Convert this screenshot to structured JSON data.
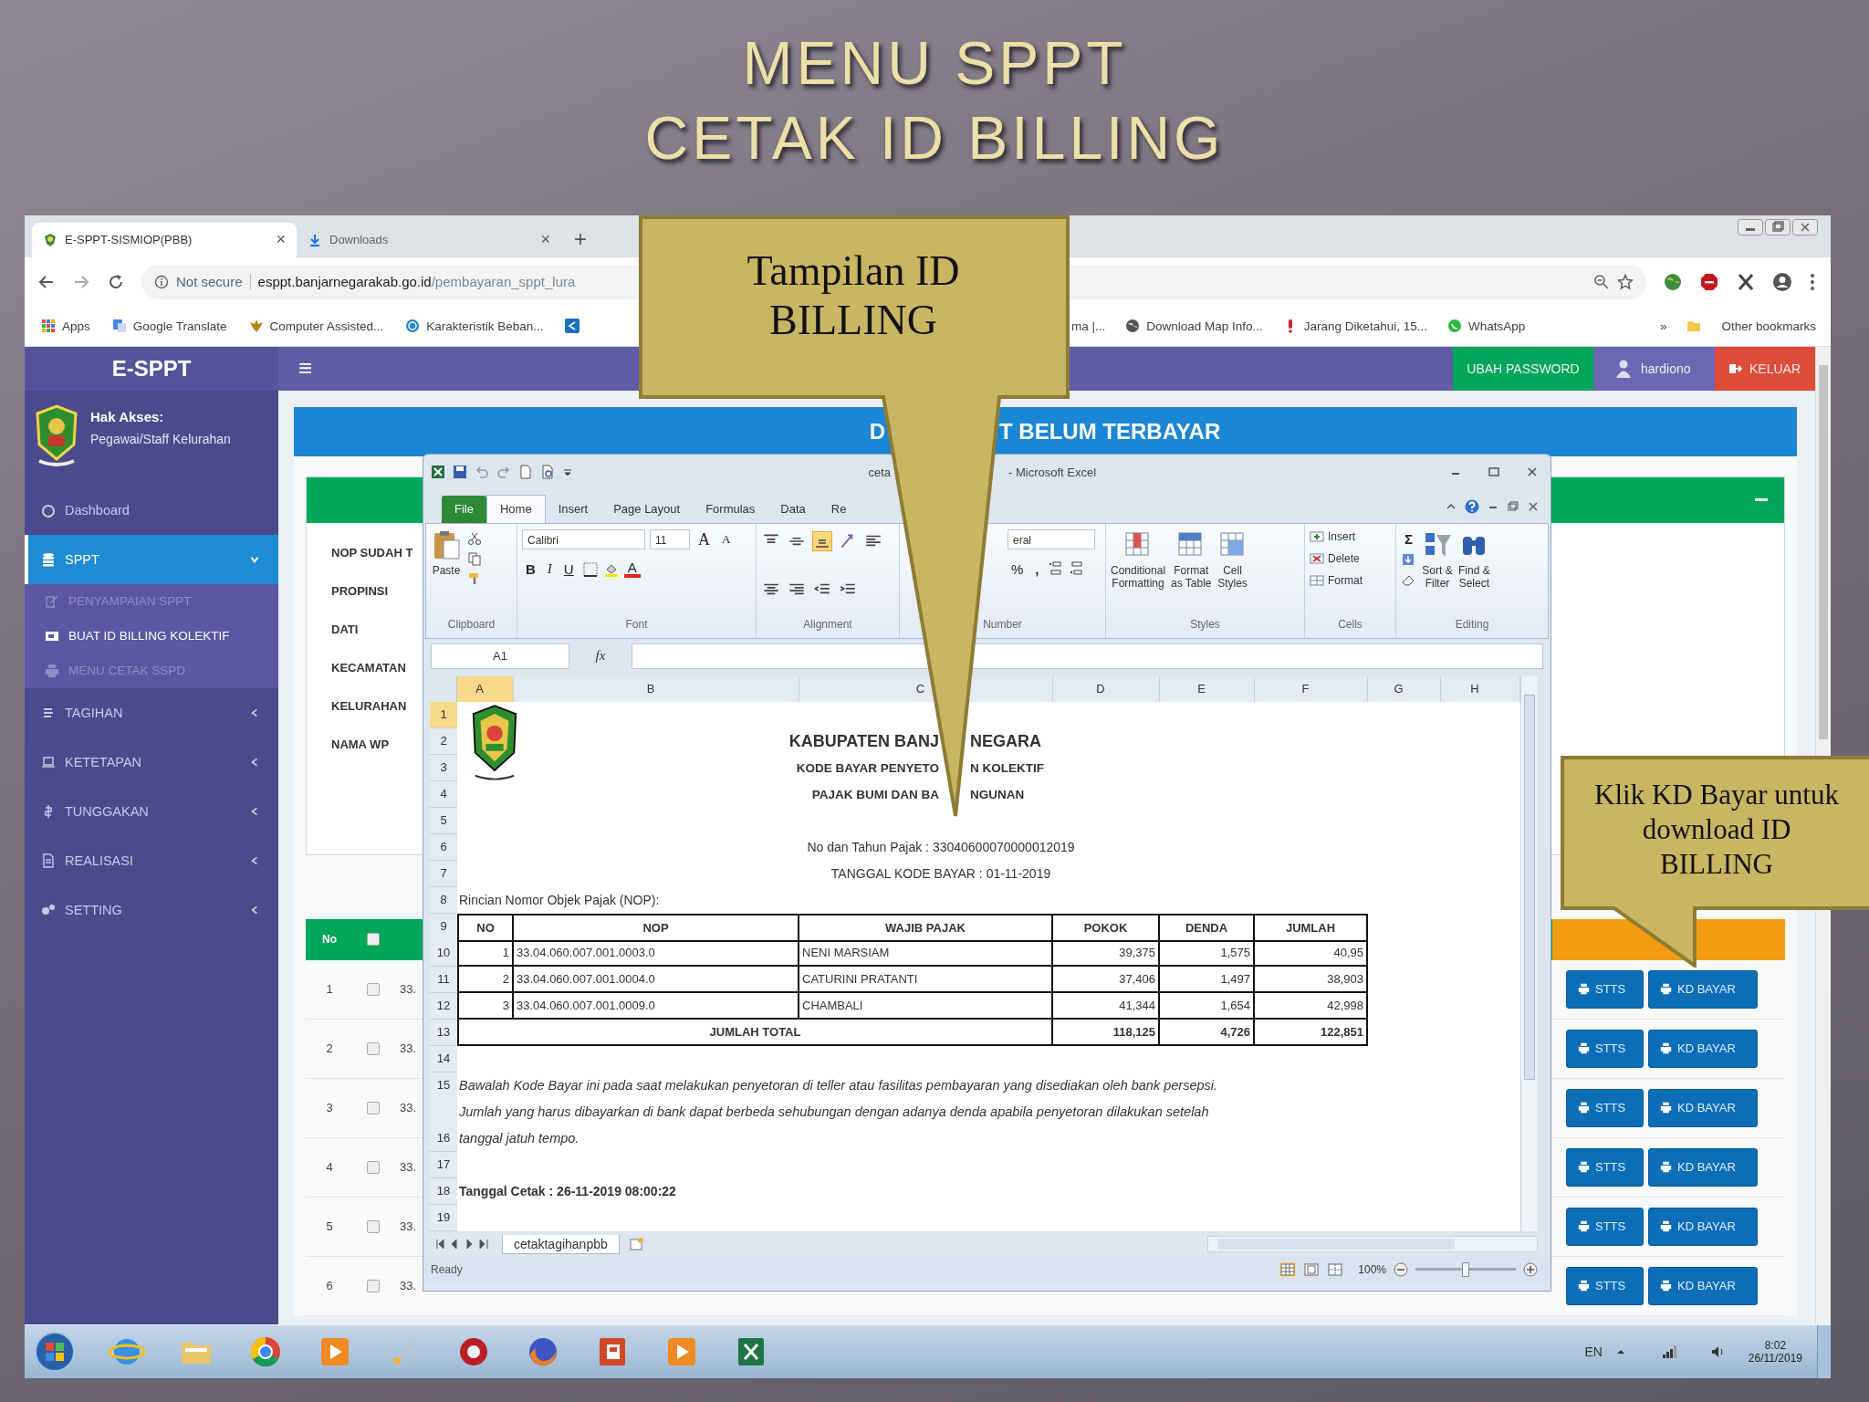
{
  "slide_title": [
    "MENU SPPT",
    "CETAK ID BILLING"
  ],
  "browser": {
    "tabs": [
      {
        "label": "E-SPPT-SISMIOP(PBB)",
        "selected": true,
        "close": "×"
      },
      {
        "label": "Downloads",
        "selected": false,
        "close": "×"
      }
    ],
    "new_tab": "+",
    "security": "Not secure",
    "url_host": "esppt.banjarnegarakab.go.id",
    "url_path": "/pembayaran_sppt_lura",
    "bookmarks_left": [
      "Apps",
      "Google Translate",
      "Computer Assisted...",
      "Karakteristik Beban..."
    ],
    "bookmarks_right": [
      "ma |...",
      "Download Map Info...",
      "Jarang Diketahui, 15...",
      "WhatsApp"
    ],
    "overflow": "»",
    "other_bookmarks": "Other bookmarks"
  },
  "app": {
    "brand": "E-SPPT",
    "menu_toggle": "≡",
    "actions": [
      {
        "label": "UBAH PASSWORD",
        "kind": "password"
      },
      {
        "label": "hardiono",
        "kind": "user"
      },
      {
        "label": "KELUAR",
        "kind": "logout"
      }
    ],
    "access_label": "Hak Akses:",
    "role": "Pegawai/Staff Kelurahan",
    "menu": [
      {
        "label": "Dashboard",
        "selected": false
      },
      {
        "label": "SPPT",
        "selected": true,
        "expanded": true,
        "children": [
          {
            "label": "PENYAMPAIAN SPPT",
            "selected": false
          },
          {
            "label": "BUAT ID BILLING KOLEKTIF",
            "selected": true
          },
          {
            "label": "MENU CETAK SSPD",
            "selected": false
          }
        ]
      },
      {
        "label": "TAGIHAN",
        "selected": false,
        "expanded": false
      },
      {
        "label": "KETETAPAN",
        "selected": false,
        "expanded": false
      },
      {
        "label": "TUNGGAKAN",
        "selected": false,
        "expanded": false
      },
      {
        "label": "REALISASI",
        "selected": false,
        "expanded": false
      },
      {
        "label": "SETTING",
        "selected": false,
        "expanded": false
      }
    ],
    "panel_title": [
      "D",
      "T BELUM TERBAYAR"
    ],
    "filters": [
      "NOP SUDAH T",
      "PROPINSI",
      "DATI",
      "KECAMATAN",
      "KELURAHAN",
      "NAMA WP"
    ],
    "table_head": {
      "number": "No",
      "checked": false
    },
    "rows": [
      {
        "number": "1",
        "checked": false,
        "nop": "33.",
        "actions": [
          "STTS",
          "KD BAYAR"
        ]
      },
      {
        "number": "2",
        "checked": false,
        "nop": "33.",
        "actions": [
          "STTS",
          "KD BAYAR"
        ]
      },
      {
        "number": "3",
        "checked": false,
        "nop": "33.",
        "actions": [
          "STTS",
          "KD BAYAR"
        ]
      },
      {
        "number": "4",
        "checked": false,
        "nop": "33.",
        "actions": [
          "STTS",
          "KD BAYAR"
        ]
      },
      {
        "number": "5",
        "checked": false,
        "nop": "33.",
        "actions": [
          "STTS",
          "KD BAYAR"
        ]
      },
      {
        "number": "6",
        "checked": false,
        "nop": "33.",
        "actions": [
          "STTS",
          "KD BAYAR"
        ]
      }
    ]
  },
  "excel": {
    "title_parts": [
      "ceta",
      "- Microsoft Excel"
    ],
    "tabs": [
      {
        "label": "File",
        "kind": "file",
        "selected": false
      },
      {
        "label": "Home",
        "kind": "tab",
        "selected": true
      },
      {
        "label": "Insert",
        "kind": "tab",
        "selected": false
      },
      {
        "label": "Page Layout",
        "kind": "tab",
        "selected": false
      },
      {
        "label": "Formulas",
        "kind": "tab",
        "selected": false
      },
      {
        "label": "Data",
        "kind": "tab",
        "selected": false
      },
      {
        "label": "Re",
        "kind": "tab",
        "selected": false
      }
    ],
    "clipboard": {
      "label": "Clipboard",
      "paste": "Paste"
    },
    "font": {
      "label": "Font",
      "family": "Calibri",
      "size": "11",
      "grow": "A",
      "shrink": "A",
      "bold": "B",
      "italic": "I",
      "underline": "U",
      "color_button": "A"
    },
    "alignment": {
      "label": "Alignment",
      "buttons": [
        {
          "kind": "top",
          "selected": false
        },
        {
          "kind": "middle",
          "selected": false
        },
        {
          "kind": "bottom",
          "selected": true
        },
        {
          "kind": "orient",
          "selected": false
        },
        {
          "kind": "left",
          "selected": false
        },
        {
          "kind": "center",
          "selected": false
        },
        {
          "kind": "right",
          "selected": false
        },
        {
          "kind": "outdent",
          "selected": false
        },
        {
          "kind": "indent",
          "selected": false
        }
      ]
    },
    "number": {
      "label": "Number",
      "format": "eral",
      "percent": "%",
      "comma": ","
    },
    "styles": {
      "label": "Styles",
      "buttons": [
        {
          "lines": [
            "Conditional",
            "Formatting"
          ],
          "kind": "conditional"
        },
        {
          "lines": [
            "Format",
            "as Table"
          ],
          "kind": "table"
        },
        {
          "lines": [
            "Cell",
            "Styles"
          ],
          "kind": "cell"
        }
      ]
    },
    "cells": {
      "label": "Cells",
      "buttons": [
        {
          "label": "Insert",
          "kind": "insert"
        },
        {
          "label": "Delete",
          "kind": "delete"
        },
        {
          "label": "Format",
          "kind": "format"
        }
      ]
    },
    "editing": {
      "label": "Editing",
      "sum": "Σ",
      "buttons": [
        {
          "lines": [
            "Sort &",
            "Filter"
          ],
          "kind": "sort"
        },
        {
          "lines": [
            "Find &",
            "Select"
          ],
          "kind": "find"
        }
      ]
    },
    "name_box": "A1",
    "function_label": "fx",
    "columns": [
      {
        "label": "A",
        "selected": true
      },
      {
        "label": "B",
        "selected": false
      },
      {
        "label": "C",
        "selected": false
      },
      {
        "label": "D",
        "selected": false
      },
      {
        "label": "E",
        "selected": false
      },
      {
        "label": "F",
        "selected": false
      },
      {
        "label": "G",
        "selected": false
      },
      {
        "label": "H",
        "selected": false
      }
    ],
    "rows": [
      {
        "label": "1",
        "selected": true,
        "kind": "blank"
      },
      {
        "label": "2",
        "selected": false,
        "kind": "title",
        "parts": [
          "KABUPATEN BANJ",
          "NEGARA"
        ]
      },
      {
        "label": "3",
        "selected": false,
        "kind": "subtitle",
        "parts": [
          "KODE BAYAR PENYETO",
          "N KOLEKTIF"
        ]
      },
      {
        "label": "4",
        "selected": false,
        "kind": "subtitle",
        "parts": [
          "PAJAK BUMI DAN BA",
          "NGUNAN"
        ]
      },
      {
        "label": "5",
        "selected": false,
        "kind": "blank"
      },
      {
        "label": "6",
        "selected": false,
        "kind": "center",
        "text": "No dan Tahun Pajak : 33040600070000012019"
      },
      {
        "label": "7",
        "selected": false,
        "kind": "center",
        "text": "TANGGAL KODE BAYAR : 01-11-2019"
      },
      {
        "label": "8",
        "selected": false,
        "kind": "left",
        "text": "Rincian Nomor Objek Pajak (NOP):"
      },
      {
        "label": "9",
        "selected": false,
        "kind": "table_head",
        "cells": [
          "NO",
          "NOP",
          "WAJIB PAJAK",
          "POKOK",
          "DENDA",
          "JUMLAH"
        ]
      },
      {
        "label": "10",
        "selected": false,
        "kind": "record",
        "cells": [
          "1",
          "33.04.060.007.001.0003.0",
          "NENI MARSIAM",
          "39,375",
          "1,575",
          "40,95"
        ]
      },
      {
        "label": "11",
        "selected": false,
        "kind": "record",
        "cells": [
          "2",
          "33.04.060.007.001.0004.0",
          "CATURINI PRATANTI",
          "37,406",
          "1,497",
          "38,903"
        ]
      },
      {
        "label": "12",
        "selected": false,
        "kind": "record",
        "cells": [
          "3",
          "33.04.060.007.001.0009.0",
          "CHAMBALI",
          "41,344",
          "1,654",
          "42,998"
        ]
      },
      {
        "label": "13",
        "selected": false,
        "kind": "total",
        "cells": [
          "JUMLAH TOTAL",
          "118,125",
          "4,726",
          "122,851"
        ]
      },
      {
        "label": "14",
        "selected": false,
        "kind": "blank"
      },
      {
        "label": "15",
        "label_2": "16",
        "selected": false,
        "kind": "note",
        "lines": [
          "Bawalah Kode Bayar ini pada saat melakukan penyetoran di teller atau fasilitas pembayaran yang disediakan oleh bank persepsi.",
          "Jumlah yang harus dibayarkan di bank dapat berbeda sehubungan dengan adanya denda apabila penyetoran dilakukan setelah",
          "tanggal jatuh tempo."
        ]
      },
      {
        "label": "17",
        "selected": false,
        "kind": "blank"
      },
      {
        "label": "18",
        "selected": false,
        "kind": "bold_left",
        "text": "Tanggal Cetak : 26-11-2019 08:00:22"
      },
      {
        "label": "19",
        "selected": false,
        "kind": "blank"
      }
    ],
    "sheet_tab": {
      "label": "cetaktagihanpbb",
      "selected": true
    },
    "status": "Ready",
    "zoom": "100%",
    "zoom_slider": {
      "level": 0.5
    },
    "views": [
      {
        "kind": "normal",
        "selected": true
      },
      {
        "kind": "layout",
        "selected": false
      },
      {
        "kind": "break",
        "selected": false
      }
    ]
  },
  "taskbar": {
    "language": "EN",
    "time": "8:02",
    "date": "26/11/2019"
  },
  "callouts": [
    {
      "lines": [
        "Tampilan ID",
        "BILLING"
      ]
    },
    {
      "lines": [
        "Klik KD Bayar untuk",
        "download ID",
        "BILLING"
      ]
    }
  ]
}
